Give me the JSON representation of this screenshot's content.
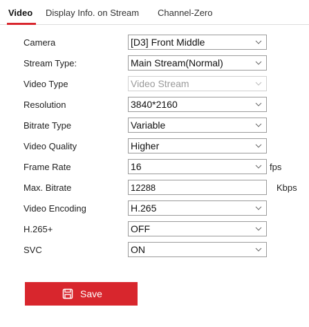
{
  "tabs": [
    {
      "label": "Video",
      "active": true
    },
    {
      "label": "Display Info. on Stream",
      "active": false
    },
    {
      "label": "Channel-Zero",
      "active": false
    }
  ],
  "form": {
    "camera": {
      "label": "Camera",
      "value": "[D3] Front Middle"
    },
    "stream_type": {
      "label": "Stream Type:",
      "value": "Main Stream(Normal)"
    },
    "video_type": {
      "label": "Video Type",
      "value": "Video Stream",
      "disabled": true
    },
    "resolution": {
      "label": "Resolution",
      "value": "3840*2160"
    },
    "bitrate_type": {
      "label": "Bitrate Type",
      "value": "Variable"
    },
    "video_quality": {
      "label": "Video Quality",
      "value": "Higher"
    },
    "frame_rate": {
      "label": "Frame Rate",
      "value": "16",
      "unit": "fps"
    },
    "max_bitrate": {
      "label": "Max. Bitrate",
      "value": "12288",
      "unit": "Kbps"
    },
    "video_encoding": {
      "label": "Video Encoding",
      "value": "H.265"
    },
    "h265plus": {
      "label": "H.265+",
      "value": "OFF"
    },
    "svc": {
      "label": "SVC",
      "value": "ON"
    }
  },
  "save_button": {
    "label": "Save",
    "icon": "save-icon"
  },
  "colors": {
    "accent": "#d8262d",
    "border": "#9a9a9a",
    "disabled_text": "#9a9a9a"
  }
}
